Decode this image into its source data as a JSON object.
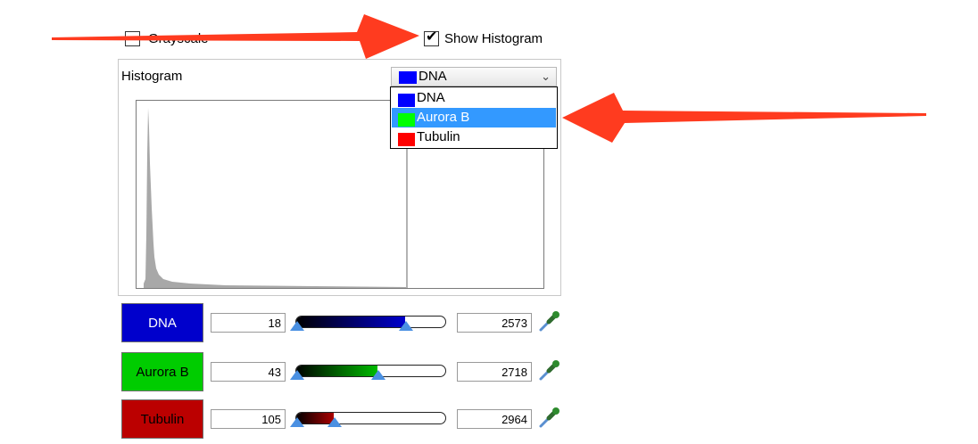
{
  "options": {
    "grayscale_label": "Grayscale",
    "grayscale_checked": false,
    "show_histogram_label": "Show Histogram",
    "show_histogram_checked": true
  },
  "histogram": {
    "label": "Histogram",
    "selected_channel": "DNA",
    "dropdown_options": [
      {
        "label": "DNA",
        "color": "#0000ff",
        "selected": false
      },
      {
        "label": "Aurora B",
        "color": "#00ff00",
        "selected": true
      },
      {
        "label": "Tubulin",
        "color": "#ff0000",
        "selected": false
      }
    ]
  },
  "channels": [
    {
      "name": "DNA",
      "button_color": "#0000cc",
      "text_color": "#ffffff",
      "min": "18",
      "max": "2573",
      "slider_color": "#0000cc",
      "low_fraction": 0.0,
      "high_fraction": 0.72
    },
    {
      "name": "Aurora B",
      "button_color": "#00cc00",
      "text_color": "#000000",
      "min": "43",
      "max": "2718",
      "slider_color": "#00bb00",
      "low_fraction": 0.0,
      "high_fraction": 0.54
    },
    {
      "name": "Tubulin",
      "button_color": "#bb0000",
      "text_color": "#000000",
      "min": "105",
      "max": "2964",
      "slider_color": "#aa0000",
      "low_fraction": 0.0,
      "high_fraction": 0.25
    }
  ],
  "annotation_color": "#ff3b1f"
}
